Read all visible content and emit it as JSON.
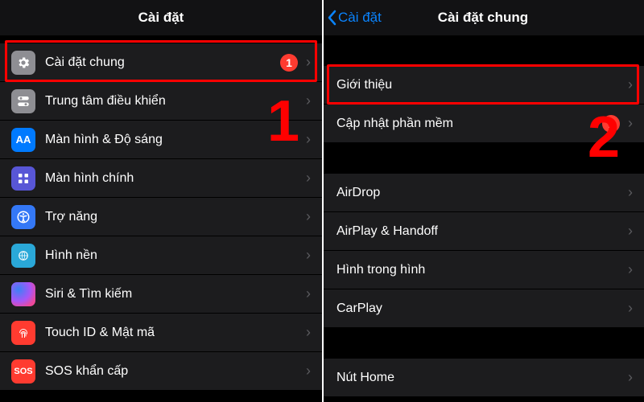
{
  "left": {
    "title": "Cài đặt",
    "items": [
      {
        "label": "Cài đặt chung",
        "badge": "1",
        "icon": "gear"
      },
      {
        "label": "Trung tâm điều khiển",
        "icon": "control-center"
      },
      {
        "label": "Màn hình & Độ sáng",
        "icon": "display"
      },
      {
        "label": "Màn hình chính",
        "icon": "home-screen"
      },
      {
        "label": "Trợ năng",
        "icon": "accessibility"
      },
      {
        "label": "Hình nền",
        "icon": "wallpaper"
      },
      {
        "label": "Siri & Tìm kiếm",
        "icon": "siri"
      },
      {
        "label": "Touch ID & Mật mã",
        "icon": "touchid"
      },
      {
        "label": "SOS khẩn cấp",
        "icon": "sos"
      }
    ],
    "step": "1"
  },
  "right": {
    "back": "Cài đặt",
    "title": "Cài đặt chung",
    "group1": [
      {
        "label": "Giới thiệu"
      },
      {
        "label": "Cập nhật phần mềm",
        "badge": "1"
      }
    ],
    "group2": [
      {
        "label": "AirDrop"
      },
      {
        "label": "AirPlay & Handoff"
      },
      {
        "label": "Hình trong hình"
      },
      {
        "label": "CarPlay"
      }
    ],
    "group3": [
      {
        "label": "Nút Home"
      }
    ],
    "step": "2"
  }
}
